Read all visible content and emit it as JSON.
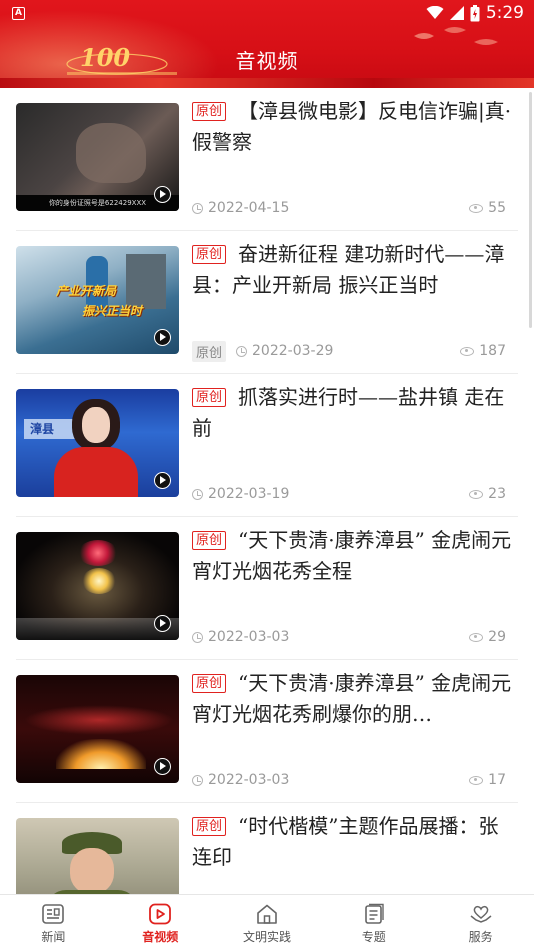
{
  "status_bar": {
    "time": "5:29",
    "notif_letter": "A"
  },
  "header": {
    "title": "音视频",
    "logo_text": "100",
    "accent": "#e0221f"
  },
  "articles": [
    {
      "tag": "原创",
      "title": "【漳县微电影】反电信诈骗|真·假警察",
      "source": "",
      "date": "2022-04-15",
      "views": "55",
      "thumb_caption": "你的身份证照号是622429XXX"
    },
    {
      "tag": "原创",
      "title": "奋进新征程 建功新时代——漳县：产业开新局 振兴正当时",
      "source": "原创",
      "date": "2022-03-29",
      "views": "187",
      "thumb_caption_1": "产业开新局",
      "thumb_caption_2": "振兴正当时"
    },
    {
      "tag": "原创",
      "title": "抓落实进行时——盐井镇 走在前",
      "source": "",
      "date": "2022-03-19",
      "views": "23",
      "thumb_caption": "漳县"
    },
    {
      "tag": "原创",
      "title": "“天下贵清·康养漳县” 金虎闹元宵灯光烟花秀全程",
      "source": "",
      "date": "2022-03-03",
      "views": "29"
    },
    {
      "tag": "原创",
      "title": "“天下贵清·康养漳县” 金虎闹元宵灯光烟花秀刷爆你的朋…",
      "source": "",
      "date": "2022-03-03",
      "views": "17"
    },
    {
      "tag": "原创",
      "title": "“时代楷模”主题作品展播：张连印",
      "source": "",
      "date": "",
      "views": ""
    }
  ],
  "bottom_nav": [
    {
      "label": "新闻",
      "icon": "news-icon",
      "active": false
    },
    {
      "label": "音视频",
      "icon": "video-icon",
      "active": true
    },
    {
      "label": "文明实践",
      "icon": "home-icon",
      "active": false
    },
    {
      "label": "专题",
      "icon": "topic-icon",
      "active": false
    },
    {
      "label": "服务",
      "icon": "service-icon",
      "active": false
    }
  ]
}
